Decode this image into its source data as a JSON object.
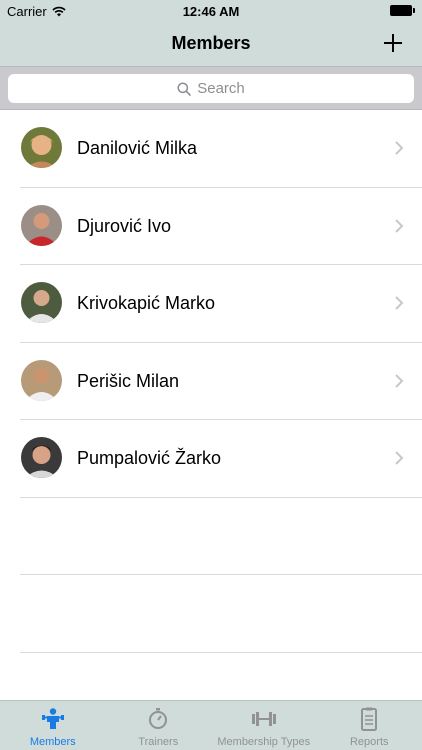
{
  "status_bar": {
    "carrier": "Carrier",
    "time": "12:46 AM"
  },
  "nav": {
    "title": "Members",
    "add_icon": "plus-icon"
  },
  "search": {
    "placeholder": "Search",
    "icon": "search-icon"
  },
  "members": [
    {
      "name": "Danilović Milka"
    },
    {
      "name": "Djurović Ivo"
    },
    {
      "name": "Krivokapić Marko"
    },
    {
      "name": "Perišic Milan"
    },
    {
      "name": "Pumpalović Žarko"
    }
  ],
  "tabs": [
    {
      "label": "Members",
      "icon": "member-icon",
      "active": true
    },
    {
      "label": "Trainers",
      "icon": "stopwatch-icon",
      "active": false
    },
    {
      "label": "Membership Types",
      "icon": "dumbbell-icon",
      "active": false
    },
    {
      "label": "Reports",
      "icon": "clipboard-icon",
      "active": false
    }
  ],
  "colors": {
    "bar_background": "#cfdcda",
    "active_tab": "#1a7ae6",
    "inactive_tab": "#929292"
  }
}
